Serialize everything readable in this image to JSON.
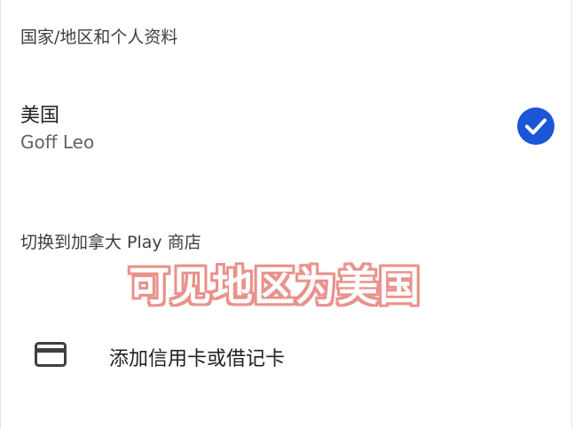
{
  "section": {
    "title": "国家/地区和个人资料"
  },
  "profile": {
    "country": "美国",
    "name": "Goff Leo",
    "selected_icon": "check-circle-icon",
    "accent_color": "#1a56d6"
  },
  "switch_store": {
    "label": "切换到加拿大 Play 商店"
  },
  "overlay": {
    "caption": "可见地区为美国",
    "stroke_color": "#e9928c"
  },
  "payment": {
    "add_card_label": "添加信用卡或借记卡",
    "icon": "credit-card-icon"
  }
}
